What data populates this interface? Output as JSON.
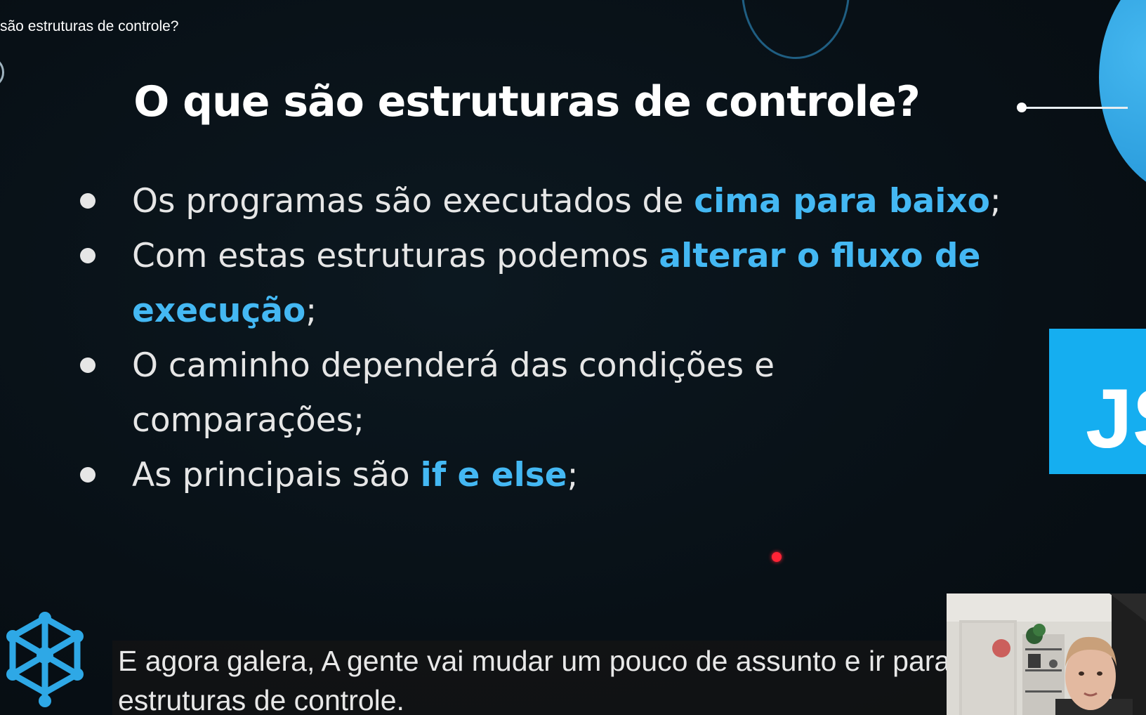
{
  "video": {
    "title_fragment": "são estruturas de controle?"
  },
  "slide": {
    "title": "O que são estruturas de controle?",
    "bullets": [
      {
        "line1_plain": "Os programas são executados de ",
        "line1_highlight": "cima para baixo",
        "line1_suffix": ";"
      },
      {
        "line1_plain": "Com estas estruturas podemos ",
        "line1_highlight": "alterar o fluxo de",
        "line2_highlight": "execução",
        "line2_suffix": ";"
      },
      {
        "line1_plain": "O caminho dependerá das condições e",
        "line2_plain": "comparações;"
      },
      {
        "line1_plain": "As principais são ",
        "line1_highlight": "if e else",
        "line1_suffix": ";"
      }
    ],
    "js_logo_text": "JS"
  },
  "captions": {
    "line1": "E agora galera, A gente vai mudar um pouco de assunto e ir para",
    "line2": "estruturas de controle."
  },
  "colors": {
    "background": "#0b1219",
    "highlight": "#44b8f3",
    "js_logo": "#15aef0",
    "laser_pointer": "#ff2436"
  },
  "icons": {
    "brand_logo": "hexagon-network-icon",
    "bullet": "bullet-dot-icon"
  }
}
